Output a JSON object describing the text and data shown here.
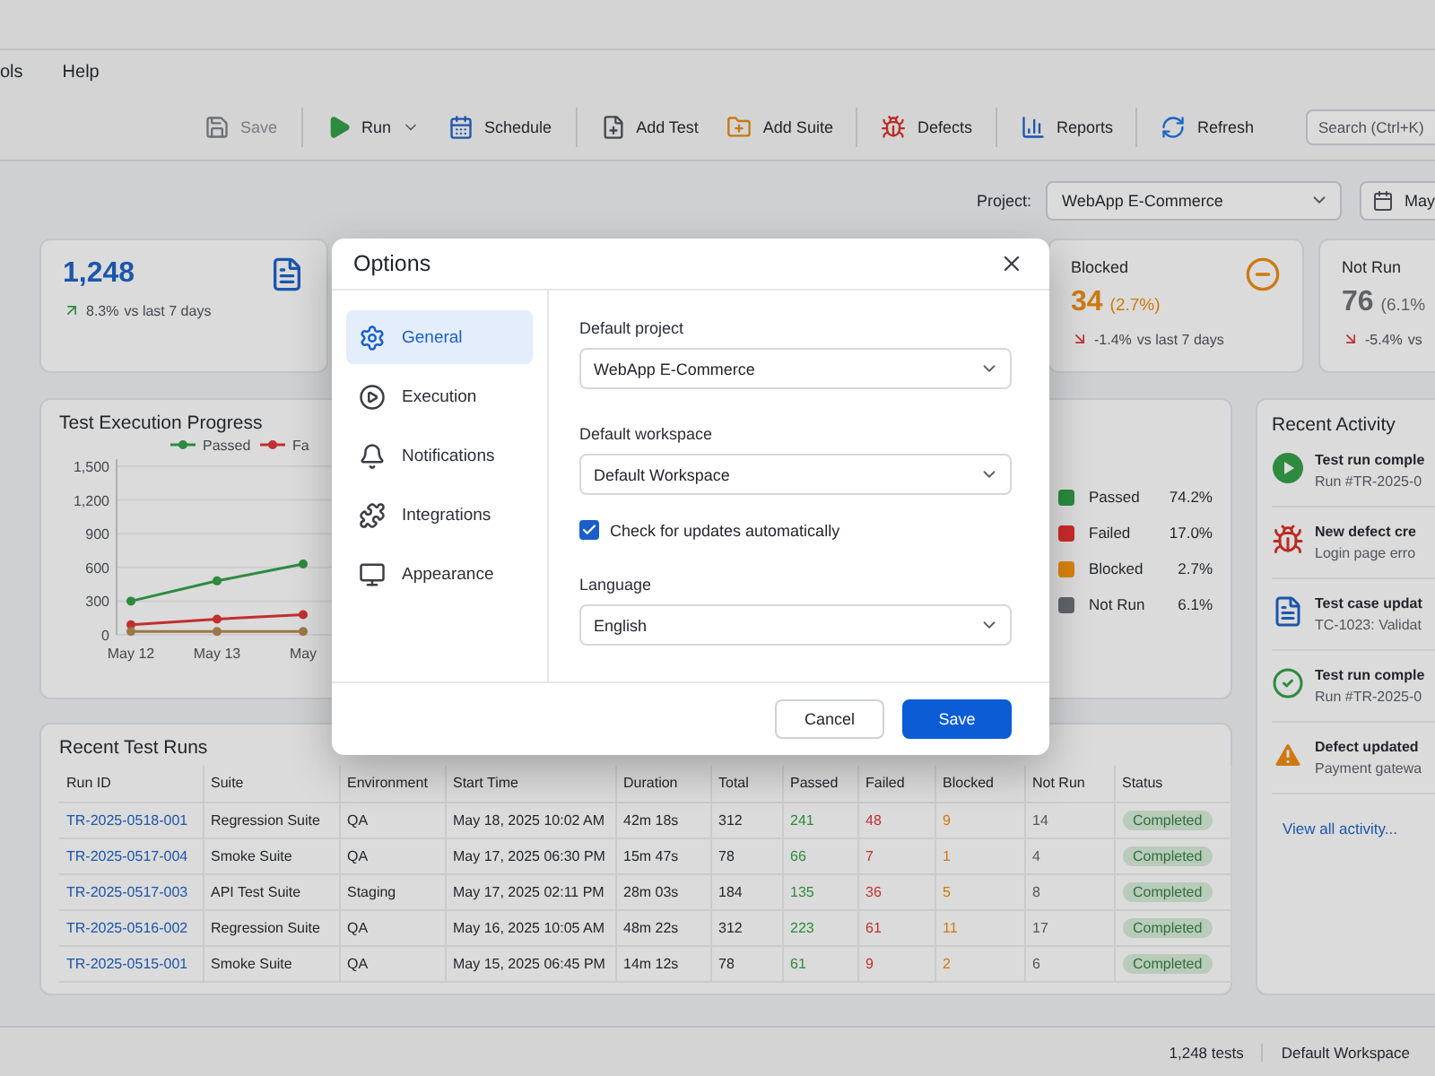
{
  "menu": [
    "ols",
    "Help"
  ],
  "toolbar": {
    "groups": [
      [
        {
          "kind": "save",
          "label": "Save",
          "disabled": true,
          "dropdown": false
        }
      ],
      [
        {
          "kind": "run",
          "label": "Run",
          "disabled": false,
          "dropdown": true
        },
        {
          "kind": "schedule",
          "label": "Schedule",
          "disabled": false,
          "dropdown": false
        }
      ],
      [
        {
          "kind": "add_test",
          "label": "Add Test",
          "disabled": false,
          "dropdown": false
        },
        {
          "kind": "add_suite",
          "label": "Add Suite",
          "disabled": false,
          "dropdown": false
        }
      ],
      [
        {
          "kind": "defects",
          "label": "Defects",
          "disabled": false,
          "dropdown": false
        }
      ],
      [
        {
          "kind": "reports",
          "label": "Reports",
          "disabled": false,
          "dropdown": false
        }
      ],
      [
        {
          "kind": "refresh",
          "label": "Refresh",
          "disabled": false,
          "dropdown": false
        }
      ]
    ],
    "search": {
      "placeholder": "Search (Ctrl+K)"
    }
  },
  "project": {
    "label": "Project:",
    "value": "WebApp E-Commerce",
    "date": "May"
  },
  "stats": [
    {
      "kind": "total",
      "value": "1,248",
      "change": "8.3%",
      "note": "vs last 7 days",
      "rising": true
    },
    {
      "kind": "blocked",
      "title": "Blocked",
      "value": "34",
      "share": "(2.7%)",
      "change": "-1.4%",
      "note": "vs last 7 days",
      "rising": false
    },
    {
      "kind": "not_run",
      "title": "Not Run",
      "value": "76",
      "share": "(6.1%",
      "change": "-5.4%",
      "note": "vs",
      "rising": false
    }
  ],
  "chart_panel": {
    "title": "Test Execution Progress",
    "chart_data": {
      "type": "line",
      "categories": [
        "May 12",
        "May 13",
        "May"
      ],
      "grid": true,
      "legend": "top",
      "series": [
        {
          "name": "Passed",
          "color": "#2f9e44",
          "marker": "circle",
          "values": [
            300,
            480,
            630
          ]
        },
        {
          "name": "Fa",
          "color": "#e03131",
          "marker": "circle",
          "values": [
            90,
            140,
            180
          ]
        },
        {
          "color": "#b5874f",
          "marker": "circle",
          "values": [
            30,
            30,
            30
          ]
        }
      ],
      "ylim": [
        0,
        1500
      ],
      "yticks": [
        0,
        300,
        600,
        900,
        {
          "value": 1200,
          "label": "1,200"
        },
        {
          "value": 1500,
          "label": "1,500"
        }
      ]
    },
    "breakdown": [
      {
        "label": "Passed",
        "value": "74.2%",
        "color": "#2b8a3e"
      },
      {
        "label": "Failed",
        "value": "17.0%",
        "color": "#c92a2a"
      },
      {
        "label": "Blocked",
        "value": "2.7%",
        "color": "#d9820f"
      },
      {
        "label": "Not Run",
        "value": "6.1%",
        "color": "#606368"
      }
    ]
  },
  "activity": {
    "title": "Recent Activity",
    "items": [
      {
        "kind": "run",
        "title": "Test run comple",
        "detail": "Run #TR-2025-0"
      },
      {
        "kind": "defect",
        "title": "New defect cre",
        "detail": "Login page erro"
      },
      {
        "kind": "doc",
        "title": "Test case updat",
        "detail": "TC-1023: Validat"
      },
      {
        "kind": "check",
        "title": "Test run comple",
        "detail": "Run #TR-2025-0"
      },
      {
        "kind": "warning",
        "title": "Defect updated",
        "detail": "Payment gatewa"
      }
    ],
    "link": "View all activity..."
  },
  "table": {
    "title": "Recent Test Runs",
    "columns": [
      {
        "label": "Run ID",
        "kind": "link"
      },
      {
        "label": "Suite",
        "kind": "text"
      },
      {
        "label": "Environment",
        "kind": "text"
      },
      {
        "label": "Start Time",
        "kind": "text"
      },
      {
        "label": "Duration",
        "kind": "text"
      },
      {
        "label": "Total",
        "kind": "text"
      },
      {
        "label": "Passed",
        "kind": "passed"
      },
      {
        "label": "Failed",
        "kind": "failed"
      },
      {
        "label": "Blocked",
        "kind": "blocked"
      },
      {
        "label": "Not Run",
        "kind": "muted"
      },
      {
        "label": "Status",
        "kind": "status"
      }
    ],
    "rows": [
      [
        "TR-2025-0518-001",
        "Regression Suite",
        "QA",
        "May 18, 2025 10:02 AM",
        "42m 18s",
        "312",
        "241",
        "48",
        "9",
        "14",
        "Completed"
      ],
      [
        "TR-2025-0517-004",
        "Smoke Suite",
        "QA",
        "May 17, 2025 06:30 PM",
        "15m 47s",
        "78",
        "66",
        "7",
        "1",
        "4",
        "Completed"
      ],
      [
        "TR-2025-0517-003",
        "API Test Suite",
        "Staging",
        "May 17, 2025 02:11 PM",
        "28m 03s",
        "184",
        "135",
        "36",
        "5",
        "8",
        "Completed"
      ],
      [
        "TR-2025-0516-002",
        "Regression Suite",
        "QA",
        "May 16, 2025 10:05 AM",
        "48m 22s",
        "312",
        "223",
        "61",
        "11",
        "17",
        "Completed"
      ],
      [
        "TR-2025-0515-001",
        "Smoke Suite",
        "QA",
        "May 15, 2025 06:45 PM",
        "14m 12s",
        "78",
        "61",
        "9",
        "2",
        "6",
        "Completed"
      ]
    ]
  },
  "status_bar": [
    "1,248 tests",
    "Default Workspace"
  ],
  "dialog": {
    "title": "Options",
    "nav": [
      {
        "kind": "general",
        "label": "General",
        "selected": true
      },
      {
        "kind": "execution",
        "label": "Execution",
        "selected": false
      },
      {
        "kind": "notifications",
        "label": "Notifications",
        "selected": false
      },
      {
        "kind": "integrations",
        "label": "Integrations",
        "selected": false
      },
      {
        "kind": "appearance",
        "label": "Appearance",
        "selected": false
      }
    ],
    "fields": [
      {
        "kind": "select",
        "label": "Default project",
        "value": "WebApp E-Commerce"
      },
      {
        "kind": "select",
        "label": "Default workspace",
        "value": "Default Workspace"
      },
      {
        "kind": "checkbox",
        "label": "Check for updates automatically",
        "checked": true
      },
      {
        "kind": "select",
        "label": "Language",
        "value": "English"
      }
    ],
    "buttons": [
      {
        "label": "Cancel",
        "primary": false
      },
      {
        "label": "Save",
        "primary": true
      }
    ]
  }
}
